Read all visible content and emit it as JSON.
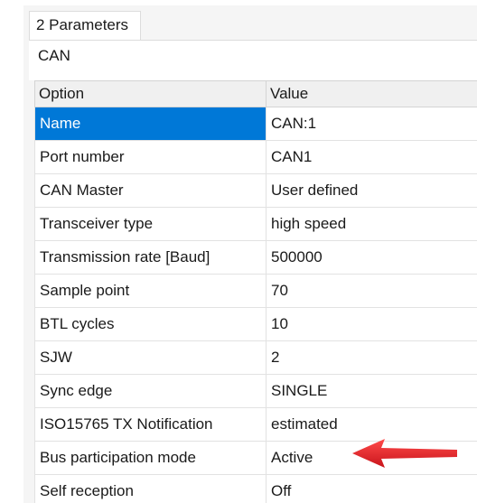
{
  "tab": {
    "label": "2 Parameters"
  },
  "group": {
    "label": "CAN"
  },
  "table": {
    "columns": [
      "Option",
      "Value"
    ],
    "rows": [
      {
        "option": "Name",
        "value": "CAN:1",
        "selected": true
      },
      {
        "option": "Port number",
        "value": "CAN1"
      },
      {
        "option": "CAN Master",
        "value": "User defined"
      },
      {
        "option": "Transceiver type",
        "value": "high speed"
      },
      {
        "option": "Transmission rate [Baud]",
        "value": "500000"
      },
      {
        "option": "Sample point",
        "value": "70"
      },
      {
        "option": "BTL cycles",
        "value": "10"
      },
      {
        "option": "SJW",
        "value": "2"
      },
      {
        "option": "Sync edge",
        "value": "SINGLE"
      },
      {
        "option": "ISO15765 TX Notification",
        "value": "estimated"
      },
      {
        "option": "Bus participation mode",
        "value": "Active"
      },
      {
        "option": "Self reception",
        "value": "Off"
      }
    ]
  },
  "annotation": {
    "icon": "red-arrow-left-icon",
    "color": "#e8232a"
  },
  "colors": {
    "selection": "#0078d7",
    "panel": "#f5f5f5"
  }
}
